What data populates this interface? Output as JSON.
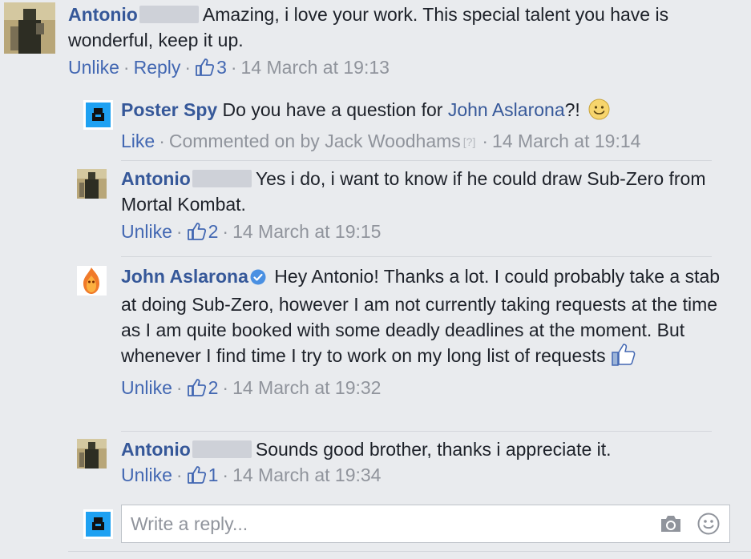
{
  "comments": [
    {
      "author": "Antonio",
      "text": "Amazing, i love your work. This special talent you have is wonderful, keep it up.",
      "action": "Unlike",
      "reply": "Reply",
      "likes": "3",
      "time": "14 March at 19:13"
    },
    {
      "author": "Poster Spy",
      "text_pre": "Do you have a question for ",
      "mention": "John Aslarona",
      "text_post": "?!",
      "action": "Like",
      "commented_by": "Commented on by Jack Woodhams",
      "qmark": "[?]",
      "time": "14 March at 19:14"
    },
    {
      "author": "Antonio",
      "text": "Yes i do, i want to know if he could draw Sub-Zero from Mortal Kombat.",
      "action": "Unlike",
      "likes": "2",
      "time": "14 March at 19:15"
    },
    {
      "author": "John Aslarona",
      "text": "Hey Antonio! Thanks a lot. I could probably take a stab at doing Sub-Zero, however I am not currently taking requests at the time as I am quite booked with some deadly deadlines at the moment. But whenever I find time I try to work on my long list of requests",
      "action": "Unlike",
      "likes": "2",
      "time": "14 March at 19:32"
    },
    {
      "author": "Antonio",
      "text": "Sounds good brother, thanks i appreciate it.",
      "action": "Unlike",
      "likes": "1",
      "time": "14 March at 19:34"
    }
  ],
  "reply_box": {
    "placeholder": "Write a reply..."
  },
  "icons": {
    "like": "thumbs-up-icon",
    "smile": "smiley-emoji-icon",
    "verified": "verified-badge-icon",
    "camera": "camera-icon",
    "emoji": "emoji-icon"
  },
  "colors": {
    "background": "#e9ebee",
    "link": "#365899",
    "meta": "#90949c",
    "action": "#4267b2",
    "posterspy": "#1ea1f2"
  }
}
